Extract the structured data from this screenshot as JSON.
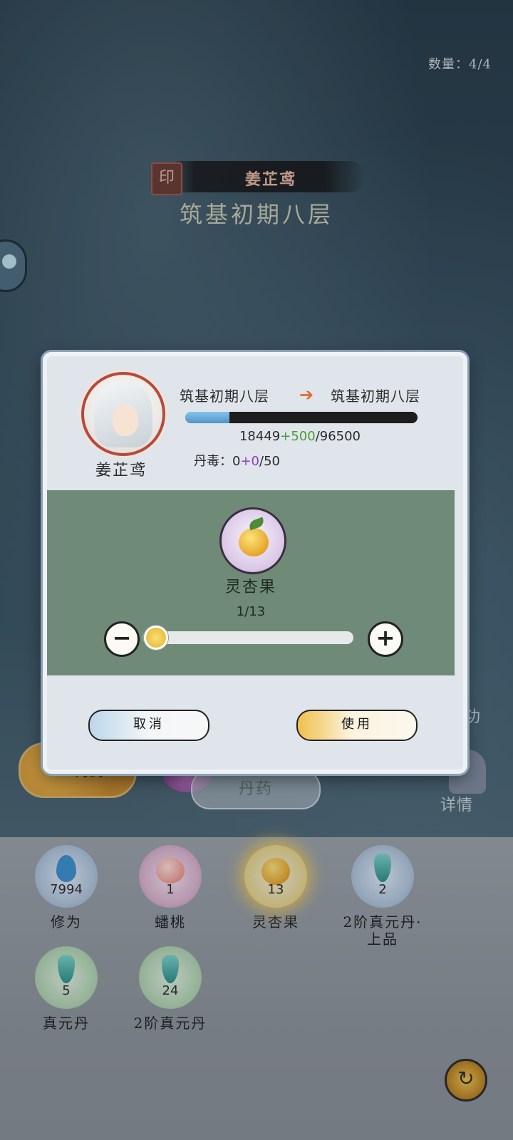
{
  "header": {
    "count_label": "数量：4/4",
    "seal_char": "印",
    "character_name": "姜芷鸢",
    "realm": "筑基初期八层"
  },
  "modal": {
    "character_name": "姜芷鸢",
    "realm_from": "筑基初期八层",
    "arrow": "➔",
    "realm_to": "筑基初期八层",
    "exp": {
      "current": "18449",
      "gain": "+500",
      "max": "/96500",
      "progress": 0.19
    },
    "poison": {
      "label": "丹毒：",
      "current": "0",
      "gain": "+0",
      "max": "/50"
    },
    "item": {
      "name": "灵杏果",
      "quantity_label": "1/13",
      "selected": 1,
      "max": 13
    },
    "minus_label": "−",
    "plus_label": "+",
    "cancel_label": "取消",
    "use_label": "使用"
  },
  "background_ui": {
    "pill_label": "丹药",
    "tab_label": "丹药",
    "right_gong": "功",
    "right_detail": "详情"
  },
  "inventory": [
    {
      "count": "7994",
      "label": "修为",
      "icon": "water-drop-icon",
      "glow": "blue"
    },
    {
      "count": "1",
      "label": "蟠桃",
      "icon": "peach-icon",
      "glow": "pink"
    },
    {
      "count": "13",
      "label": "灵杏果",
      "icon": "apricot-icon",
      "glow": "gold"
    },
    {
      "count": "2",
      "label": "2阶真元丹·上品",
      "icon": "bottle-icon",
      "glow": "blue"
    },
    {
      "count": "5",
      "label": "真元丹",
      "icon": "bottle-icon",
      "glow": "green"
    },
    {
      "count": "24",
      "label": "2阶真元丹",
      "icon": "bottle-icon",
      "glow": "green"
    }
  ],
  "corner_button": "↻",
  "colors": {
    "modal_bg": "#dfe5eb",
    "panel_green": "#6f8b77",
    "exp_fill": "#4f93c7",
    "gain_green": "#4b9b3a",
    "gain_purple": "#8a3fb8"
  }
}
